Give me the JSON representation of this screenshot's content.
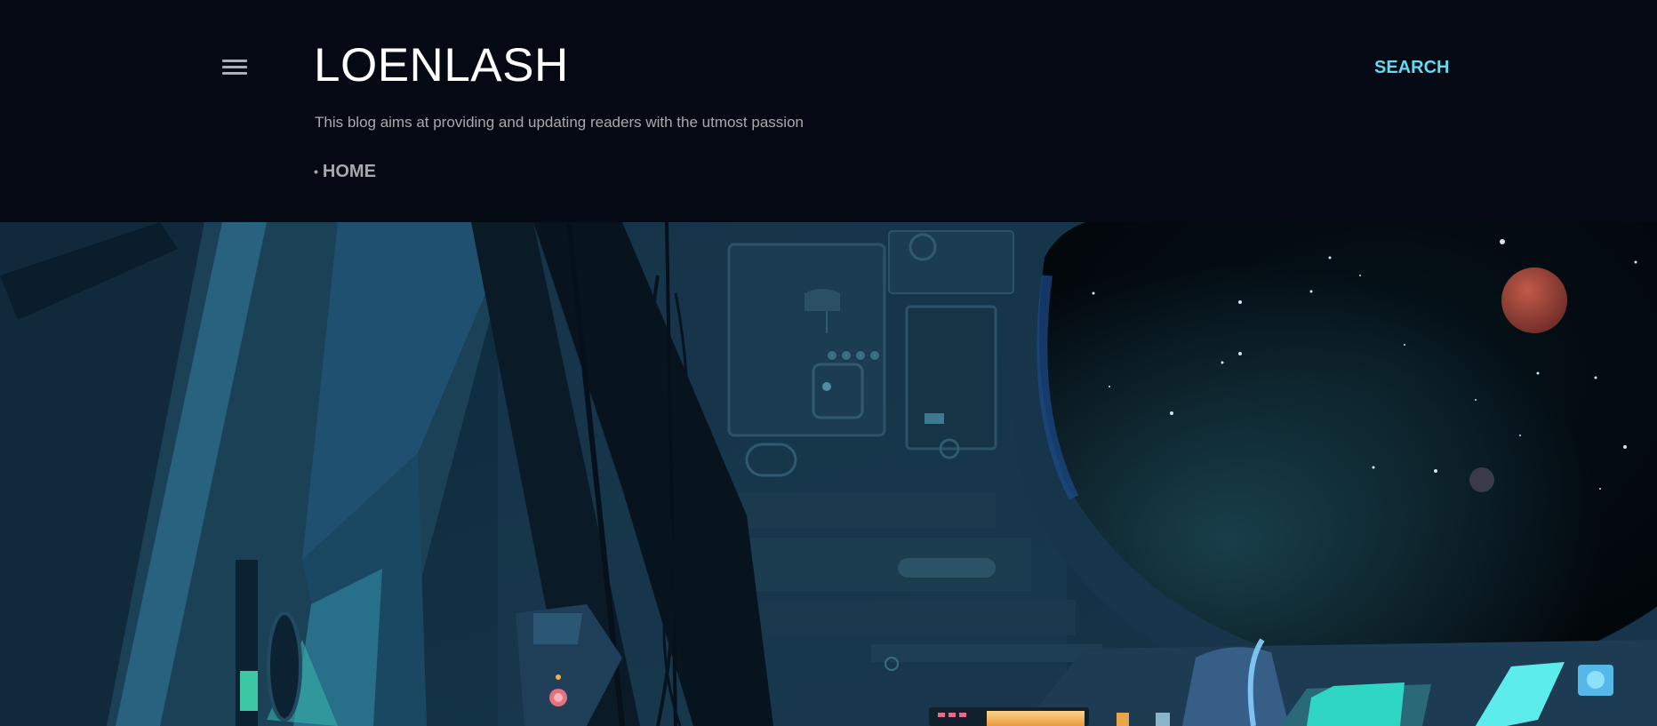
{
  "header": {
    "menu_icon": "hamburger-menu-icon",
    "title": "LOENLASH",
    "description": "This blog aims at providing and updating readers with the utmost passion",
    "nav": [
      {
        "label": "HOME"
      }
    ],
    "search_label": "SEARCH",
    "colors": {
      "background": "#040914",
      "title": "#ffffff",
      "accent": "#5fdcf2",
      "muted": "#a9a9ad"
    }
  },
  "hero": {
    "image": "spaceship-cockpit-illustration"
  }
}
